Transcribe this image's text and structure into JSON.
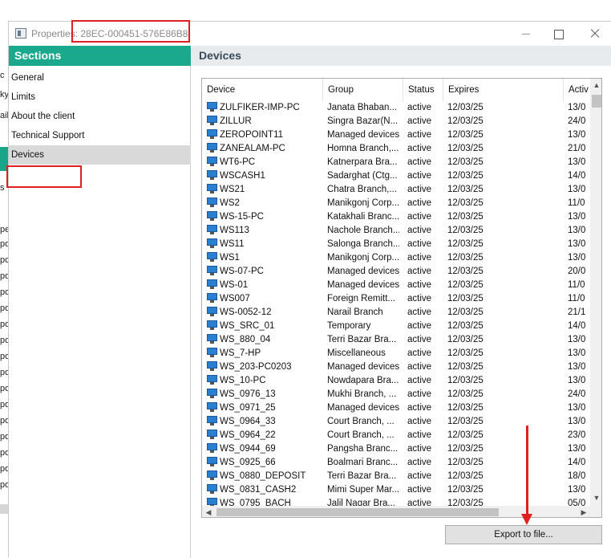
{
  "background_app": {
    "fragments": [
      "c",
      "ky",
      "ail",
      "s",
      "pe",
      "po",
      "po",
      "po",
      "po",
      "po",
      "po",
      "po",
      "po",
      "po",
      "po",
      "po",
      "po",
      "po",
      "po",
      "po",
      "po"
    ]
  },
  "window": {
    "title_prefix": "Properties:",
    "title_id": "28EC-000451-576E86B8",
    "controls": {
      "minimize": "",
      "maximize": "",
      "close": ""
    }
  },
  "sidebar": {
    "header": "Sections",
    "items": [
      {
        "label": "General",
        "selected": false
      },
      {
        "label": "Limits",
        "selected": false
      },
      {
        "label": "About the client",
        "selected": false
      },
      {
        "label": "Technical Support",
        "selected": false
      },
      {
        "label": "Devices",
        "selected": true
      }
    ]
  },
  "main": {
    "header": "Devices",
    "columns": [
      "Device",
      "Group",
      "Status",
      "Expires",
      "Activ"
    ],
    "rows": [
      [
        "ZULFIKER-IMP-PC",
        "Janata Bhaban...",
        "active",
        "12/03/25",
        "13/0"
      ],
      [
        "ZILLUR",
        "Singra Bazar(N...",
        "active",
        "12/03/25",
        "24/0"
      ],
      [
        "ZEROPOINT11",
        "Managed devices",
        "active",
        "12/03/25",
        "13/0"
      ],
      [
        "ZANEALAM-PC",
        "Homna Branch,...",
        "active",
        "12/03/25",
        "21/0"
      ],
      [
        "WT6-PC",
        "Katnerpara Bra...",
        "active",
        "12/03/25",
        "13/0"
      ],
      [
        "WSCASH1",
        "Sadarghat (Ctg...",
        "active",
        "12/03/25",
        "14/0"
      ],
      [
        "WS21",
        "Chatra Branch,...",
        "active",
        "12/03/25",
        "13/0"
      ],
      [
        "WS2",
        "Manikgonj Corp...",
        "active",
        "12/03/25",
        "11/0"
      ],
      [
        "WS-15-PC",
        "Katakhali Branc...",
        "active",
        "12/03/25",
        "13/0"
      ],
      [
        "WS113",
        "Nachole Branch...",
        "active",
        "12/03/25",
        "13/0"
      ],
      [
        "WS11",
        "Salonga Branch...",
        "active",
        "12/03/25",
        "13/0"
      ],
      [
        "WS1",
        "Manikgonj Corp...",
        "active",
        "12/03/25",
        "13/0"
      ],
      [
        "WS-07-PC",
        "Managed devices",
        "active",
        "12/03/25",
        "20/0"
      ],
      [
        "WS-01",
        "Managed devices",
        "active",
        "12/03/25",
        "11/0"
      ],
      [
        "WS007",
        "Foreign Remitt...",
        "active",
        "12/03/25",
        "11/0"
      ],
      [
        "WS-0052-12",
        "Narail Branch",
        "active",
        "12/03/25",
        "21/1"
      ],
      [
        "WS_SRC_01",
        "Temporary",
        "active",
        "12/03/25",
        "14/0"
      ],
      [
        "WS_880_04",
        "Terri Bazar Bra...",
        "active",
        "12/03/25",
        "13/0"
      ],
      [
        "WS_7-HP",
        "Miscellaneous",
        "active",
        "12/03/25",
        "13/0"
      ],
      [
        "WS_203-PC0203",
        "Managed devices",
        "active",
        "12/03/25",
        "13/0"
      ],
      [
        "WS_10-PC",
        "Nowdapara Bra...",
        "active",
        "12/03/25",
        "13/0"
      ],
      [
        "WS_0976_13",
        "Mukhi Branch, ...",
        "active",
        "12/03/25",
        "24/0"
      ],
      [
        "WS_0971_25",
        "Managed devices",
        "active",
        "12/03/25",
        "13/0"
      ],
      [
        "WS_0964_33",
        "Court Branch, ...",
        "active",
        "12/03/25",
        "13/0"
      ],
      [
        "WS_0964_22",
        "Court Branch, ...",
        "active",
        "12/03/25",
        "23/0"
      ],
      [
        "WS_0944_69",
        "Pangsha Branc...",
        "active",
        "12/03/25",
        "13/0"
      ],
      [
        "WS_0925_66",
        "Boalmari Branc...",
        "active",
        "12/03/25",
        "14/0"
      ],
      [
        "WS_0880_DEPOSIT",
        "Terri Bazar Bra...",
        "active",
        "12/03/25",
        "18/0"
      ],
      [
        "WS_0831_CASH2",
        "Mimi Super Mar...",
        "active",
        "12/03/25",
        "13/0"
      ],
      [
        "WS_0795_BACH",
        "Jalil Nagar Bra...",
        "active",
        "12/03/25",
        "05/0"
      ]
    ],
    "export_button": "Export to file..."
  },
  "colors": {
    "accent_green": "#1ba98e",
    "annotation_red": "#e02020",
    "selected_bg": "#d9d9d9",
    "header_bg": "#e7ebed"
  },
  "icons": {
    "device": "monitor-icon",
    "app": "window-app-icon"
  }
}
